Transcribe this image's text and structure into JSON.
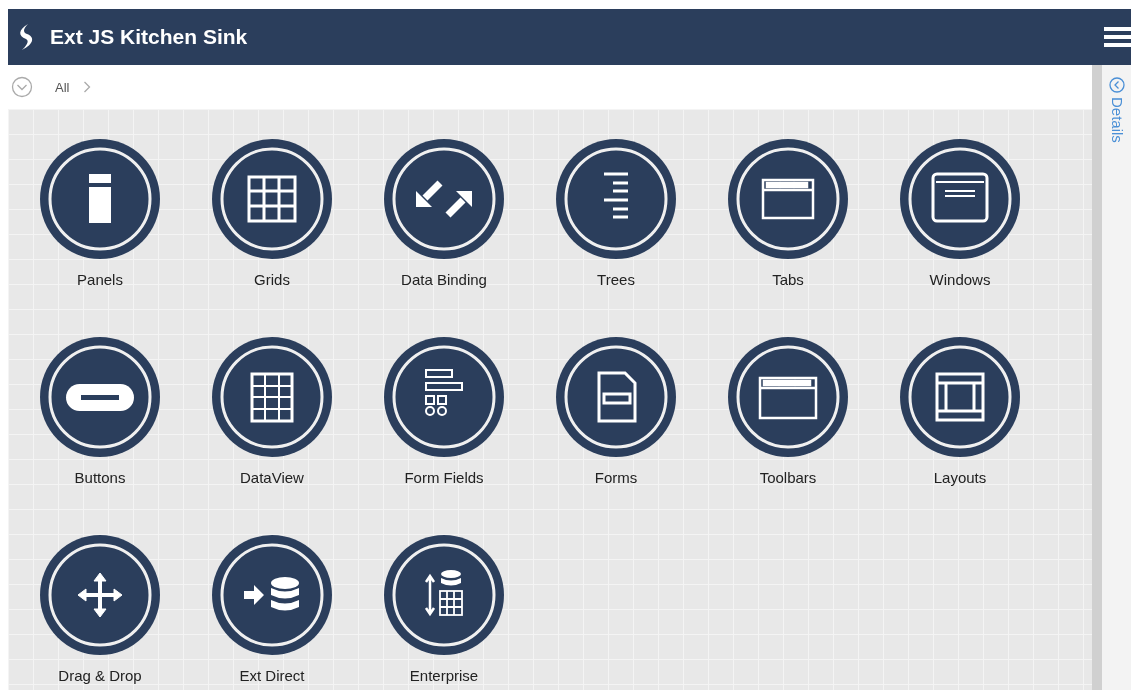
{
  "header": {
    "title": "Ext JS Kitchen Sink"
  },
  "breadcrumb": {
    "items": [
      "All"
    ]
  },
  "details_panel": {
    "title": "Details"
  },
  "examples": [
    {
      "label": "Panels",
      "kind": "panels"
    },
    {
      "label": "Grids",
      "kind": "grids"
    },
    {
      "label": "Data Binding",
      "kind": "binding"
    },
    {
      "label": "Trees",
      "kind": "trees"
    },
    {
      "label": "Tabs",
      "kind": "tabs"
    },
    {
      "label": "Windows",
      "kind": "windows"
    },
    {
      "label": "Buttons",
      "kind": "buttons"
    },
    {
      "label": "DataView",
      "kind": "dataview"
    },
    {
      "label": "Form Fields",
      "kind": "formfields"
    },
    {
      "label": "Forms",
      "kind": "forms"
    },
    {
      "label": "Toolbars",
      "kind": "toolbars"
    },
    {
      "label": "Layouts",
      "kind": "layouts"
    },
    {
      "label": "Drag & Drop",
      "kind": "dnd"
    },
    {
      "label": "Ext Direct",
      "kind": "direct"
    },
    {
      "label": "Enterprise",
      "kind": "enterprise"
    }
  ]
}
